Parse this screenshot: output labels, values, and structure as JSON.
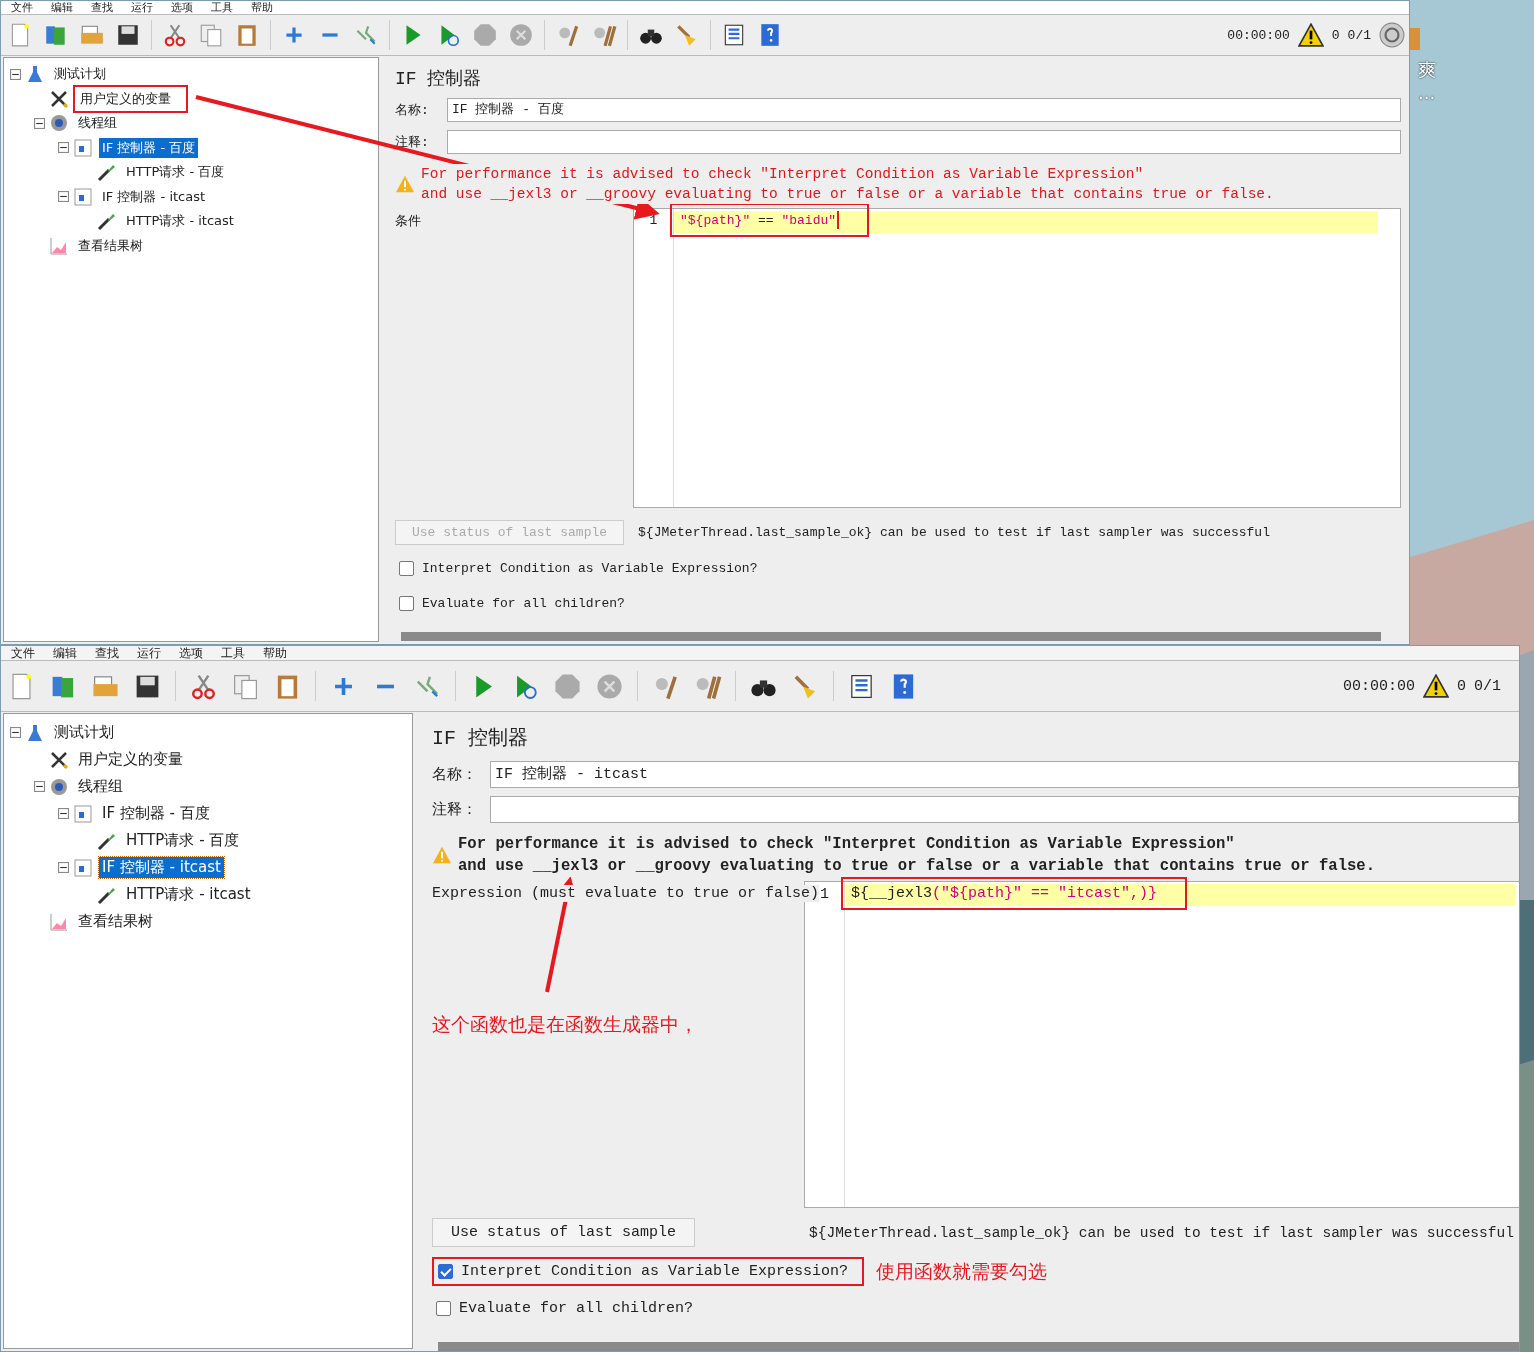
{
  "desktop": {
    "labels": [
      "爽",
      "..."
    ]
  },
  "windows": [
    {
      "menu": [
        "文件",
        "编辑",
        "查找",
        "运行",
        "选项",
        "工具",
        "帮助"
      ],
      "status": {
        "time": "00:00:00",
        "warnings": "0",
        "threads": "0/1"
      },
      "tree": [
        {
          "label": "测试计划",
          "kind": "plan",
          "expanded": true,
          "selected": false,
          "annotated": false,
          "children": [
            {
              "label": "用户定义的变量",
              "kind": "vars",
              "selected": false,
              "annotated": true
            },
            {
              "label": "线程组",
              "kind": "threads",
              "expanded": true,
              "selected": false,
              "annotated": false,
              "children": [
                {
                  "label": "IF 控制器 - 百度",
                  "kind": "if",
                  "expanded": true,
                  "selected": true,
                  "annotated": false,
                  "children": [
                    {
                      "label": "HTTP请求 - 百度",
                      "kind": "http",
                      "selected": false,
                      "annotated": false
                    }
                  ]
                },
                {
                  "label": "IF 控制器 - itcast",
                  "kind": "if",
                  "expanded": true,
                  "selected": false,
                  "annotated": false,
                  "children": [
                    {
                      "label": "HTTP请求 - itcast",
                      "kind": "http",
                      "selected": false,
                      "annotated": false
                    }
                  ]
                }
              ]
            },
            {
              "label": "查看结果树",
              "kind": "listener",
              "selected": false,
              "annotated": false
            }
          ]
        }
      ],
      "panel": {
        "title": "IF 控制器",
        "name_label": "名称:",
        "name_value": "IF 控制器 - 百度",
        "comment_label": "注释:",
        "warning": {
          "lines": [
            "For performance it is advised to check \"Interpret Condition as Variable Expression\"",
            "and use __jexl3 or __groovy evaluating to true or false or a variable that contains true or false."
          ]
        },
        "condition_label": "条件",
        "editor": {
          "line_number": "1",
          "annotated": true,
          "caret": true,
          "tokens": [
            {
              "text": "\"${path}\"",
              "kind": "string"
            },
            {
              "text": " == ",
              "kind": "plain"
            },
            {
              "text": "\"baidu\"",
              "kind": "string"
            }
          ]
        },
        "use_status_button": {
          "label": "Use status of last sample",
          "disabled": true
        },
        "hint": "${JMeterThread.last_sample_ok} can be used to test if last sampler was successful",
        "checkboxes": [
          {
            "label": "Interpret Condition as Variable Expression?",
            "checked": false,
            "annotated": false
          },
          {
            "label": "Evaluate for all children?",
            "checked": false,
            "annotated": false
          }
        ]
      }
    },
    {
      "menu": [
        "文件",
        "编辑",
        "查找",
        "运行",
        "选项",
        "工具",
        "帮助"
      ],
      "status": {
        "time": "00:00:00",
        "warnings": "0",
        "threads": "0/1"
      },
      "tree": [
        {
          "label": "测试计划",
          "kind": "plan",
          "expanded": true,
          "selected": false,
          "annotated": false,
          "children": [
            {
              "label": "用户定义的变量",
              "kind": "vars",
              "selected": false,
              "annotated": false
            },
            {
              "label": "线程组",
              "kind": "threads",
              "expanded": true,
              "selected": false,
              "annotated": false,
              "children": [
                {
                  "label": "IF 控制器 - 百度",
                  "kind": "if",
                  "expanded": true,
                  "selected": false,
                  "annotated": false,
                  "children": [
                    {
                      "label": "HTTP请求 - 百度",
                      "kind": "http",
                      "selected": false,
                      "annotated": false
                    }
                  ]
                },
                {
                  "label": "IF 控制器 - itcast",
                  "kind": "if",
                  "expanded": true,
                  "selected": true,
                  "annotated": false,
                  "children": [
                    {
                      "label": "HTTP请求 - itcast",
                      "kind": "http",
                      "selected": false,
                      "annotated": false
                    }
                  ]
                }
              ]
            },
            {
              "label": "查看结果树",
              "kind": "listener",
              "selected": false,
              "annotated": false
            }
          ]
        }
      ],
      "panel": {
        "title": "IF 控制器",
        "name_label": "名称：",
        "name_value": "IF 控制器 - itcast",
        "comment_label": "注释：",
        "warning": {
          "lines": [
            "For performance it is advised to check \"Interpret Condition as Variable Expression\"",
            "and use __jexl3 or __groovy evaluating to true or false or a variable that contains true or false."
          ]
        },
        "condition_label": "Expression (must evaluate to true or false)",
        "condition_note": "这个函数也是在函数生成器中，",
        "editor": {
          "line_number": "1",
          "annotated": true,
          "caret": false,
          "tokens": [
            {
              "text": "${",
              "kind": "plain"
            },
            {
              "text": "__jexl3",
              "kind": "plain"
            },
            {
              "text": "(",
              "kind": "string"
            },
            {
              "text": "\"${path}\" == \"itcast\"",
              "kind": "string"
            },
            {
              "text": ",)}",
              "kind": "string"
            }
          ]
        },
        "use_status_button": {
          "label": "Use status of last sample",
          "disabled": false
        },
        "hint": "${JMeterThread.last_sample_ok} can be used to test if last sampler was successful",
        "checkboxes": [
          {
            "label": "Interpret Condition as Variable Expression?",
            "checked": true,
            "annotated": true,
            "note": "使用函数就需要勾选"
          },
          {
            "label": "Evaluate for all children?",
            "checked": false,
            "annotated": false
          }
        ]
      }
    }
  ]
}
